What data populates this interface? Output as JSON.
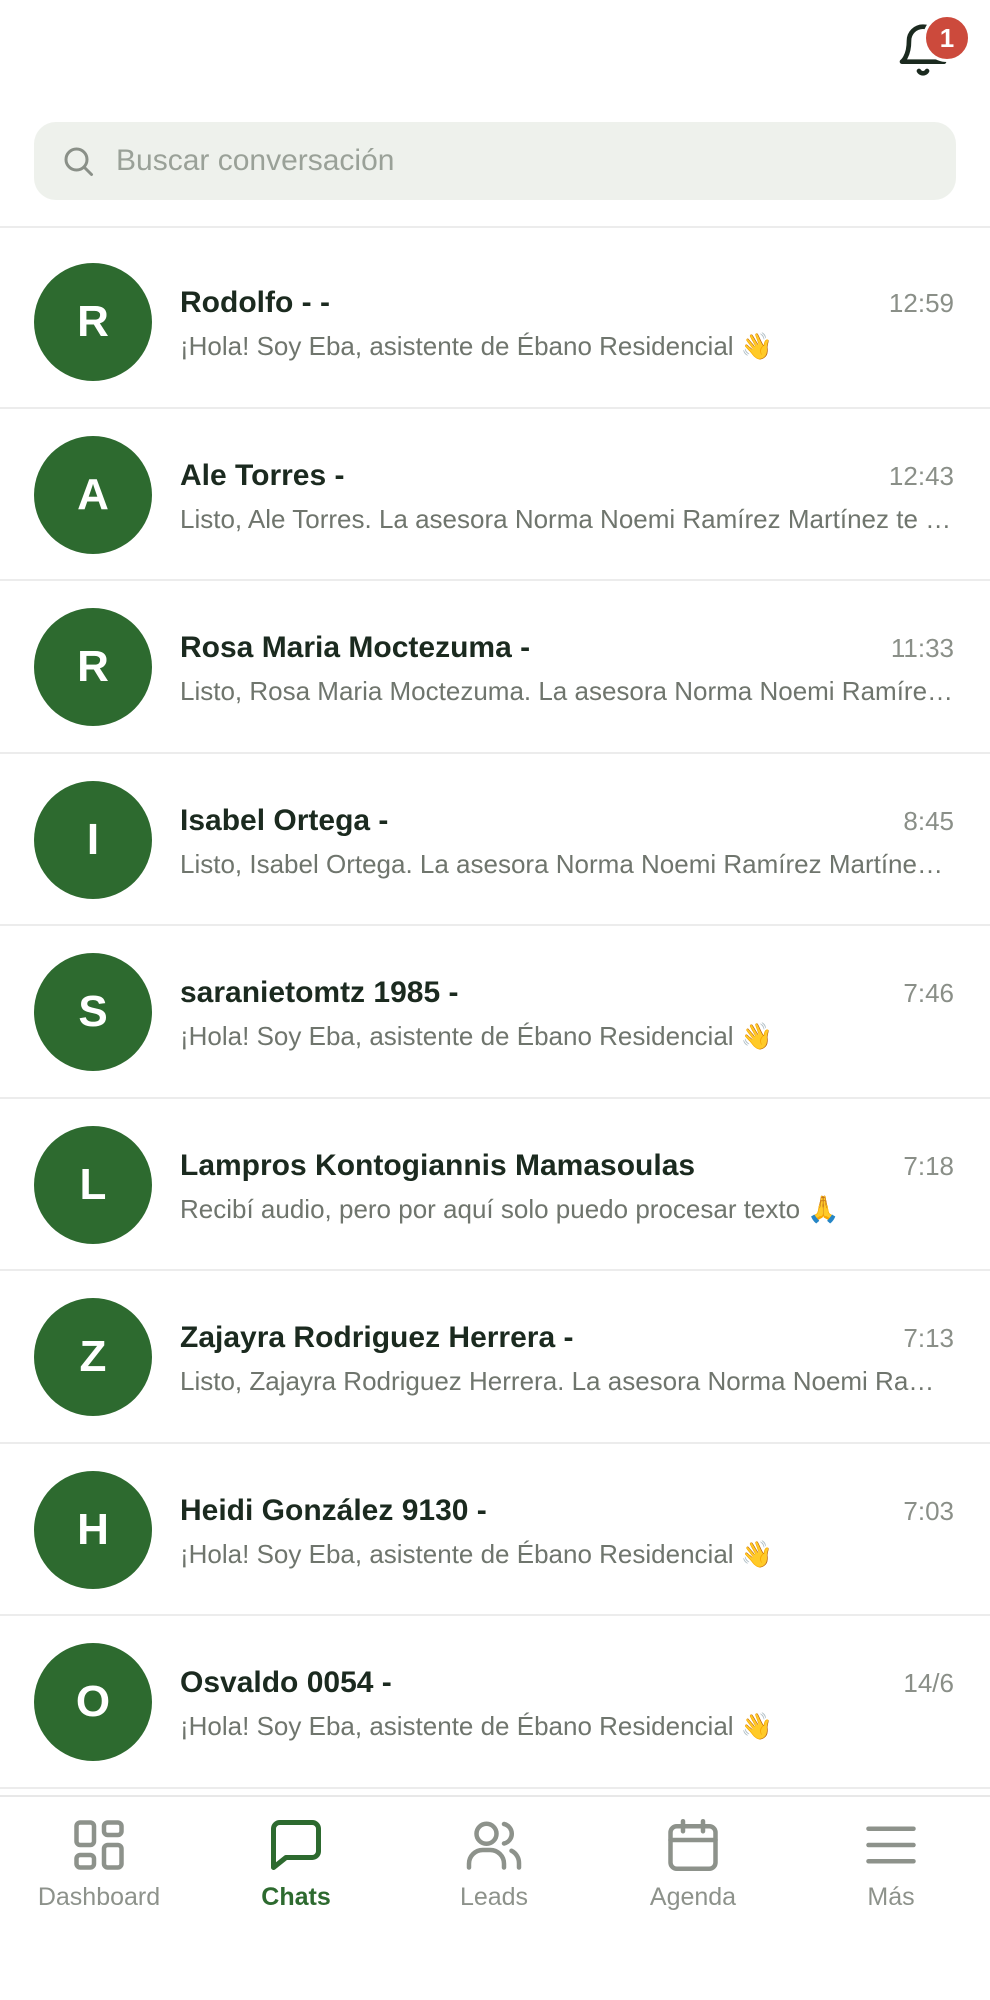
{
  "header": {
    "notification_count": "1"
  },
  "search": {
    "placeholder": "Buscar conversación"
  },
  "conversations": [
    {
      "initial": "R",
      "name": "Rodolfo - -",
      "time": "12:59",
      "preview": "¡Hola! Soy Eba, asistente de Ébano Residencial 👋"
    },
    {
      "initial": "A",
      "name": "Ale Torres -",
      "time": "12:43",
      "preview": "Listo, Ale Torres. La asesora Norma Noemi Ramírez Martínez te contactará pronto."
    },
    {
      "initial": "R",
      "name": "Rosa Maria Moctezuma -",
      "time": "11:33",
      "preview": "Listo, Rosa Maria Moctezuma. La asesora Norma Noemi Ramírez Martínez te contactará pronto."
    },
    {
      "initial": "I",
      "name": "Isabel Ortega -",
      "time": "8:45",
      "preview": "Listo, Isabel Ortega. La asesora Norma Noemi Ramírez Martínez te contactará pronto."
    },
    {
      "initial": "S",
      "name": "saranietomtz 1985 -",
      "time": "7:46",
      "preview": "¡Hola! Soy Eba, asistente de Ébano Residencial 👋"
    },
    {
      "initial": "L",
      "name": "Lampros Kontogiannis Mamasoulas",
      "time": "7:18",
      "preview": "Recibí audio, pero por aquí solo puedo procesar texto 🙏"
    },
    {
      "initial": "Z",
      "name": "Zajayra Rodriguez Herrera -",
      "time": "7:13",
      "preview": "Listo, Zajayra Rodriguez Herrera. La asesora Norma Noemi Ramírez Martínez te contactará pronto."
    },
    {
      "initial": "H",
      "name": "Heidi González 9130 -",
      "time": "7:03",
      "preview": "¡Hola! Soy Eba, asistente de Ébano Residencial 👋"
    },
    {
      "initial": "O",
      "name": "Osvaldo 0054 -",
      "time": "14/6",
      "preview": "¡Hola! Soy Eba, asistente de Ébano Residencial 👋"
    }
  ],
  "nav": {
    "items": [
      {
        "label": "Dashboard",
        "icon": "grid-icon"
      },
      {
        "label": "Chats",
        "icon": "chat-bubble-icon",
        "active": true
      },
      {
        "label": "Leads",
        "icon": "users-icon"
      },
      {
        "label": "Agenda",
        "icon": "calendar-icon"
      },
      {
        "label": "Más",
        "icon": "menu-icon"
      }
    ]
  },
  "colors": {
    "brand_green": "#2d6a2f",
    "badge_red": "#cc4a3c",
    "search_bg": "#eef1ec",
    "inactive_gray": "#8d928b"
  }
}
